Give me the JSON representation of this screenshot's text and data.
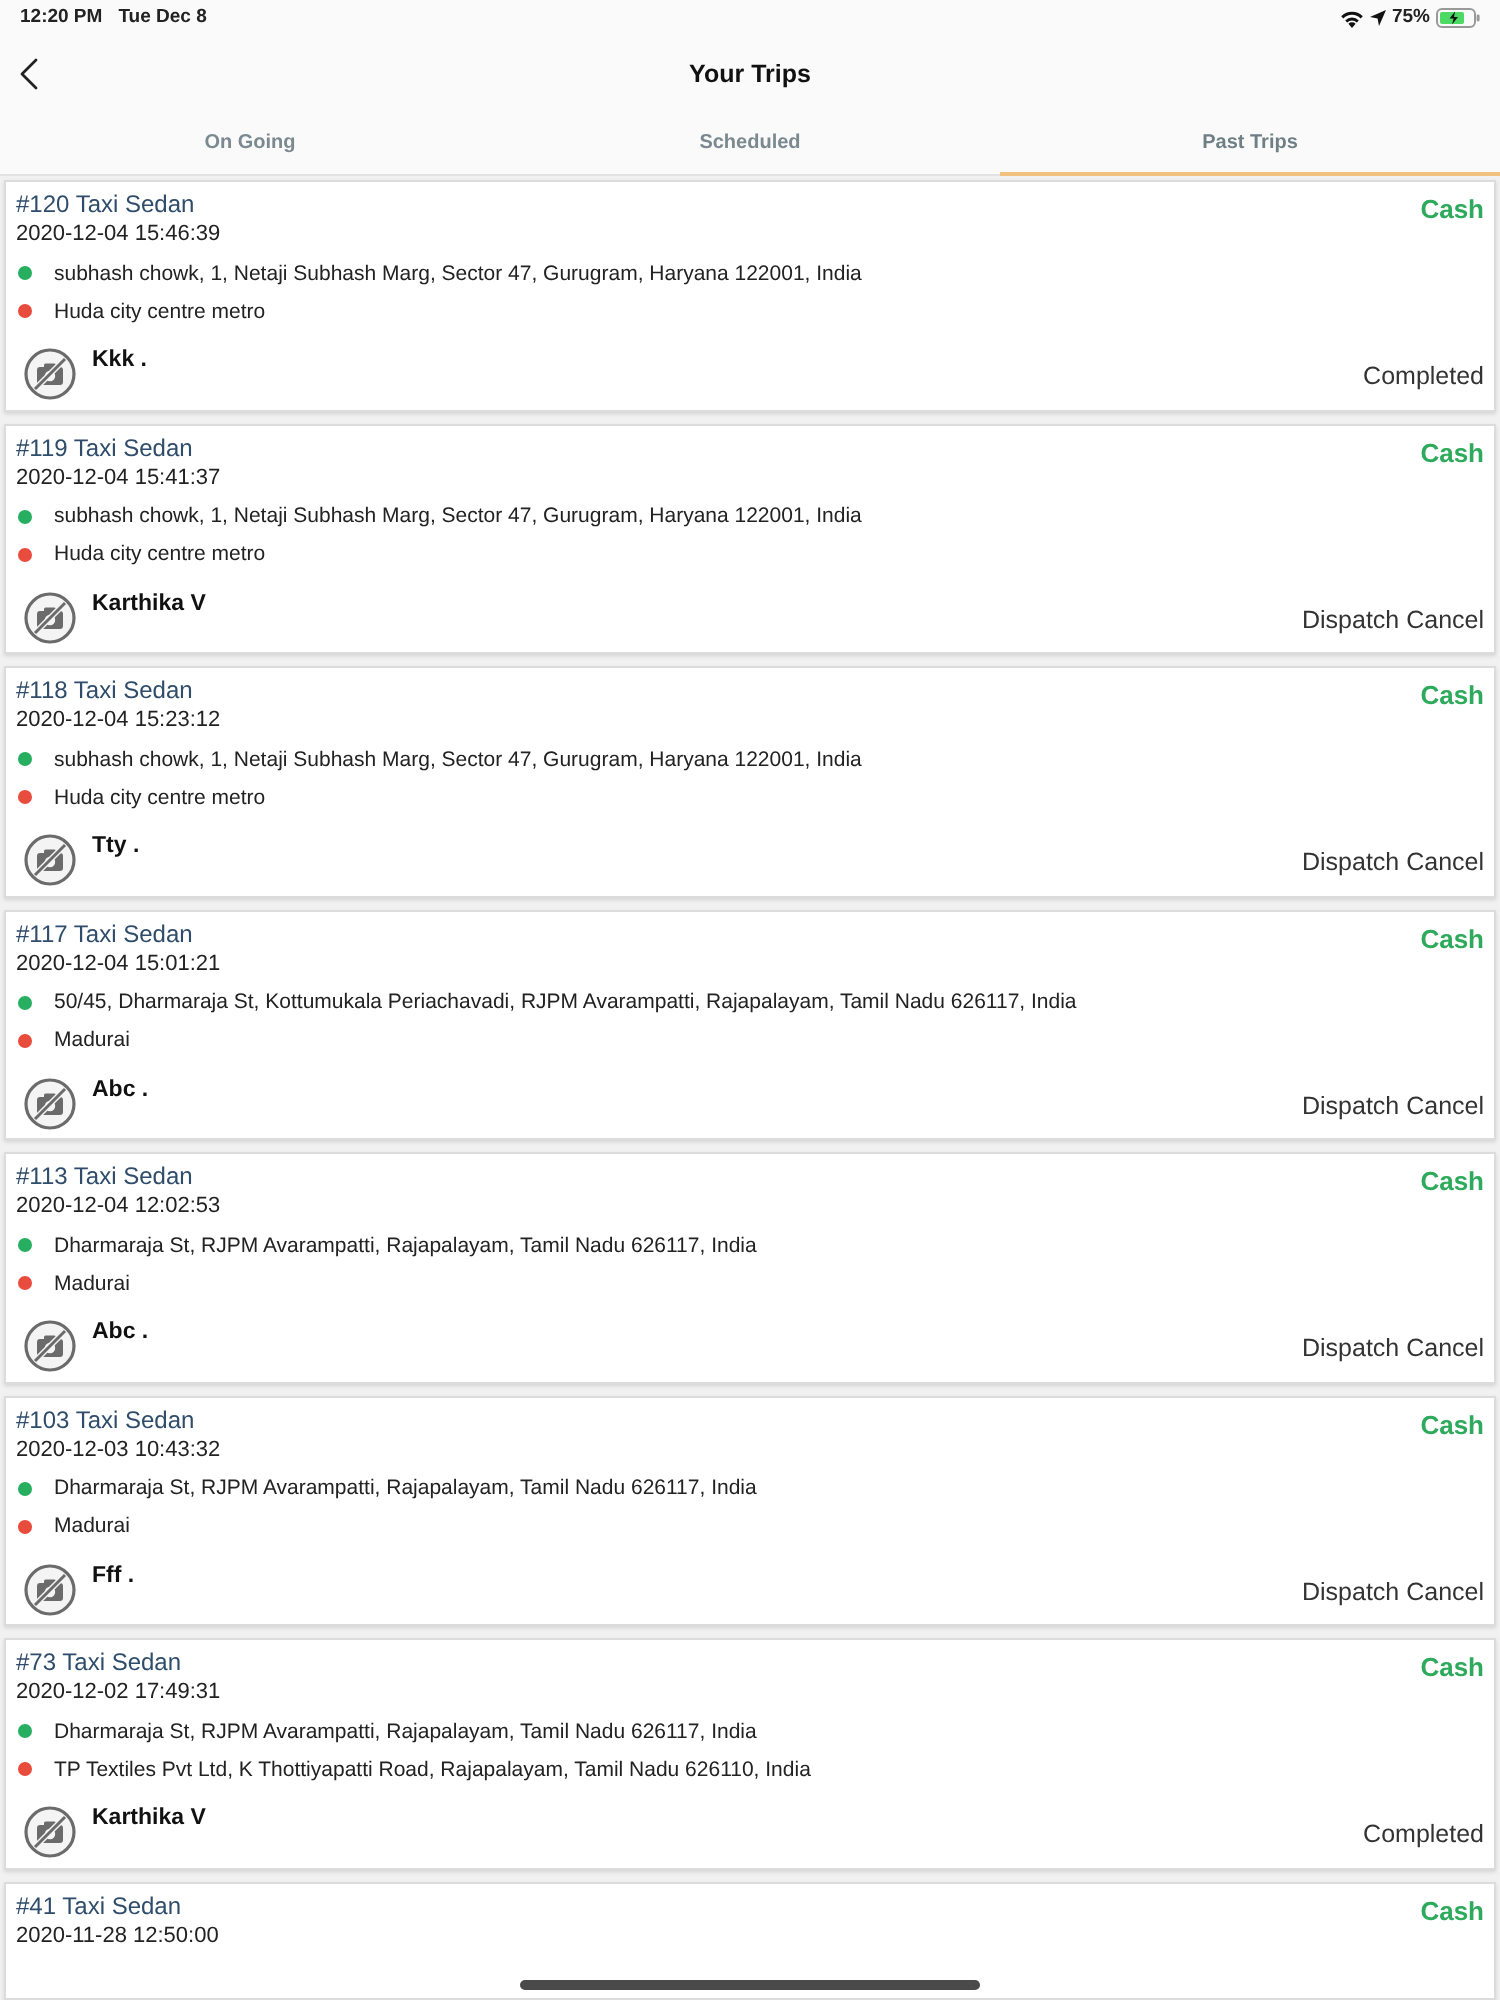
{
  "status_bar": {
    "time": "12:20 PM",
    "date": "Tue Dec 8",
    "battery": "75%"
  },
  "header": {
    "title": "Your Trips"
  },
  "tabs": [
    {
      "label": "On Going",
      "selected": false
    },
    {
      "label": "Scheduled",
      "selected": false
    },
    {
      "label": "Past Trips",
      "selected": true
    }
  ],
  "trips": [
    {
      "title": "#120 Taxi Sedan",
      "datetime": "2020-12-04 15:46:39",
      "payment": "Cash",
      "pickup": "subhash chowk, 1, Netaji Subhash Marg, Sector 47, Gurugram, Haryana 122001, India",
      "dropoff": "Huda city centre metro",
      "driver": "Kkk .",
      "status": "Completed"
    },
    {
      "title": "#119 Taxi Sedan",
      "datetime": "2020-12-04 15:41:37",
      "payment": "Cash",
      "pickup": "subhash chowk, 1, Netaji Subhash Marg, Sector 47, Gurugram, Haryana 122001, India",
      "dropoff": "Huda city centre metro",
      "driver": "Karthika V",
      "status": "Dispatch Cancel"
    },
    {
      "title": "#118 Taxi Sedan",
      "datetime": "2020-12-04 15:23:12",
      "payment": "Cash",
      "pickup": "subhash chowk, 1, Netaji Subhash Marg, Sector 47, Gurugram, Haryana 122001, India",
      "dropoff": "Huda city centre metro",
      "driver": "Tty .",
      "status": "Dispatch Cancel"
    },
    {
      "title": "#117 Taxi Sedan",
      "datetime": "2020-12-04 15:01:21",
      "payment": "Cash",
      "pickup": "50/45, Dharmaraja St, Kottumukala Periachavadi, RJPM Avarampatti, Rajapalayam, Tamil Nadu 626117, India",
      "dropoff": "Madurai",
      "driver": "Abc .",
      "status": "Dispatch Cancel"
    },
    {
      "title": "#113 Taxi Sedan",
      "datetime": "2020-12-04 12:02:53",
      "payment": "Cash",
      "pickup": "Dharmaraja St, RJPM Avarampatti, Rajapalayam, Tamil Nadu 626117, India",
      "dropoff": "Madurai",
      "driver": "Abc .",
      "status": "Dispatch Cancel"
    },
    {
      "title": "#103 Taxi Sedan",
      "datetime": "2020-12-03 10:43:32",
      "payment": "Cash",
      "pickup": "Dharmaraja St, RJPM Avarampatti, Rajapalayam, Tamil Nadu 626117, India",
      "dropoff": "Madurai",
      "driver": "Fff .",
      "status": "Dispatch Cancel"
    },
    {
      "title": "#73 Taxi Sedan",
      "datetime": "2020-12-02 17:49:31",
      "payment": "Cash",
      "pickup": "Dharmaraja St, RJPM Avarampatti, Rajapalayam, Tamil Nadu 626117, India",
      "dropoff": "TP Textiles Pvt Ltd, K Thottiyapatti Road, Rajapalayam, Tamil Nadu 626110, India",
      "driver": "Karthika V",
      "status": "Completed"
    },
    {
      "title": "#41 Taxi Sedan",
      "datetime": "2020-11-28 12:50:00",
      "payment": "Cash"
    }
  ]
}
